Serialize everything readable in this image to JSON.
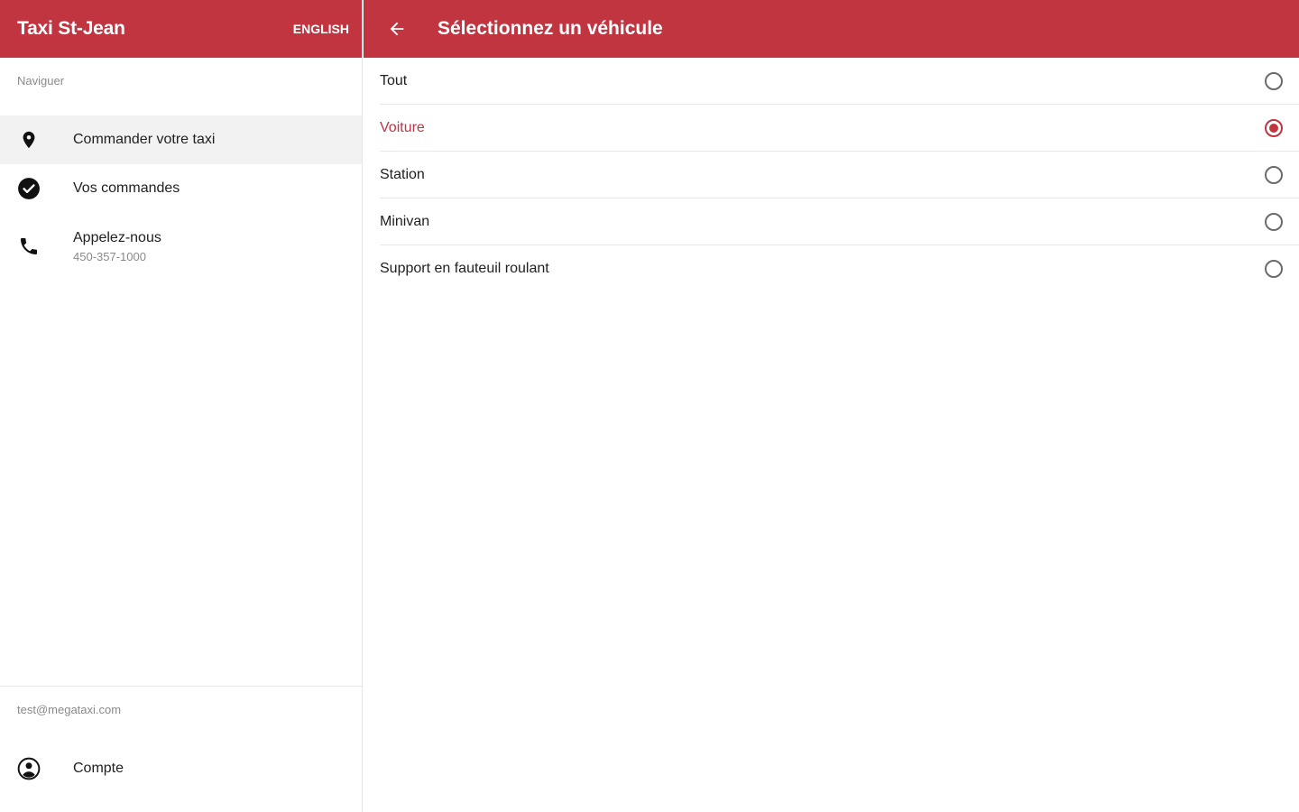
{
  "colors": {
    "accent": "#c13541",
    "text": "#212121",
    "muted": "#8a8a8a"
  },
  "drawer": {
    "brand": "Taxi St-Jean",
    "language_button": "ENGLISH",
    "section_label": "Naviguer",
    "items": [
      {
        "label": "Commander votre taxi",
        "icon": "location-pin-icon",
        "active": true
      },
      {
        "label": "Vos commandes",
        "icon": "check-circle-icon",
        "active": false
      },
      {
        "label": "Appelez-nous",
        "sublabel": "450-357-1000",
        "icon": "phone-icon",
        "active": false
      }
    ],
    "footer": {
      "email": "test@megataxi.com",
      "account_label": "Compte",
      "account_icon": "account-circle-icon"
    }
  },
  "panel": {
    "back_icon": "arrow-back-icon",
    "title": "Sélectionnez un véhicule",
    "options": [
      {
        "label": "Tout",
        "selected": false
      },
      {
        "label": "Voiture",
        "selected": true
      },
      {
        "label": "Station",
        "selected": false
      },
      {
        "label": "Minivan",
        "selected": false
      },
      {
        "label": "Support en fauteuil roulant",
        "selected": false
      }
    ]
  }
}
